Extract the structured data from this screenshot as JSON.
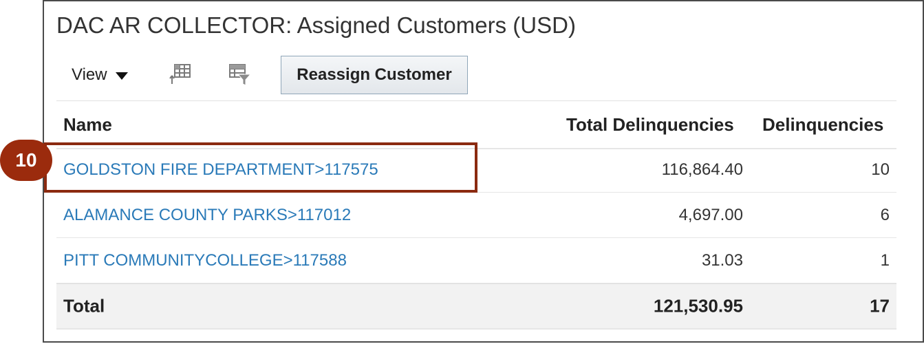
{
  "panel": {
    "title": "DAC AR COLLECTOR: Assigned Customers (USD)"
  },
  "toolbar": {
    "view_label": "View",
    "freeze_icon": "freeze-columns-icon",
    "filter_icon": "query-by-example-icon",
    "reassign_label": "Reassign Customer"
  },
  "table": {
    "columns": [
      "Name",
      "Total Delinquencies",
      "Delinquencies"
    ],
    "rows": [
      {
        "name": "GOLDSTON FIRE DEPARTMENT>117575",
        "total_delinquencies": "116,864.40",
        "delinquencies": "10"
      },
      {
        "name": "ALAMANCE COUNTY PARKS>117012",
        "total_delinquencies": "4,697.00",
        "delinquencies": "6"
      },
      {
        "name": "PITT COMMUNITYCOLLEGE>117588",
        "total_delinquencies": "31.03",
        "delinquencies": "1"
      }
    ],
    "total": {
      "label": "Total",
      "total_delinquencies": "121,530.95",
      "delinquencies": "17"
    }
  },
  "annotation": {
    "step_number": "10",
    "accent_color": "#9b2b0d"
  },
  "colors": {
    "link": "#2a7ab8",
    "border": "#4a4a4a"
  }
}
